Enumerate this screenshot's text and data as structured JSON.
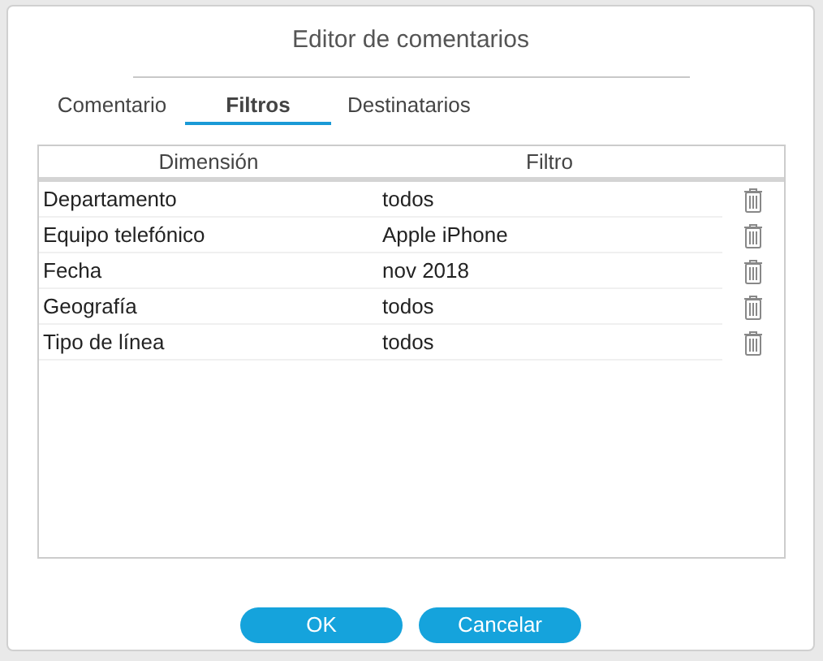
{
  "dialog": {
    "title": "Editor de comentarios"
  },
  "tabs": [
    {
      "label": "Comentario",
      "selected": false
    },
    {
      "label": "Filtros",
      "selected": true
    },
    {
      "label": "Destinatarios",
      "selected": false
    }
  ],
  "table": {
    "columns": [
      "Dimensión",
      "Filtro"
    ],
    "rows": [
      {
        "dimension": "Departamento",
        "filter": "todos"
      },
      {
        "dimension": "Equipo telefónico",
        "filter": "Apple iPhone"
      },
      {
        "dimension": "Fecha",
        "filter": "nov 2018"
      },
      {
        "dimension": "Geografía",
        "filter": "todos"
      },
      {
        "dimension": "Tipo de línea",
        "filter": "todos"
      }
    ]
  },
  "buttons": [
    "OK",
    "Cancelar"
  ]
}
